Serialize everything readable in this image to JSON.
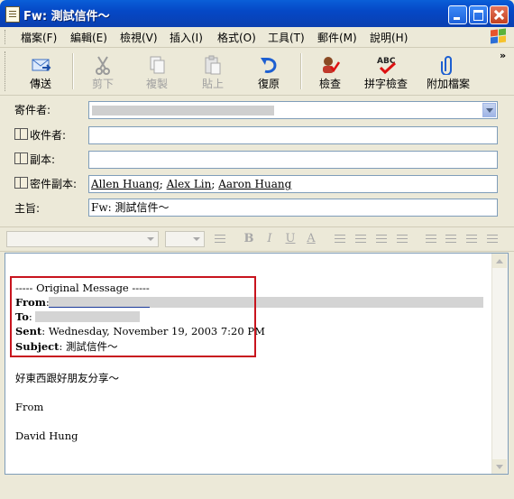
{
  "window": {
    "title": "Fw: 測試信件～"
  },
  "menu": [
    "檔案(F)",
    "編輯(E)",
    "檢視(V)",
    "插入(I)",
    "格式(O)",
    "工具(T)",
    "郵件(M)",
    "說明(H)"
  ],
  "toolbar": {
    "send": "傳送",
    "cut": "剪下",
    "copy": "複製",
    "paste": "貼上",
    "undo": "復原",
    "check": "檢查",
    "spell": "拼字檢查",
    "attach": "附加檔案",
    "more": "»"
  },
  "fields": {
    "from_label": "寄件者:",
    "to_label": "收件者:",
    "cc_label": "副本:",
    "bcc_label": "密件副本:",
    "subject_label": "主旨:",
    "to_value": "",
    "cc_value": "",
    "bcc_names": [
      "Allen Huang",
      "Alex Lin",
      "Aaron Huang"
    ],
    "bcc_sep": ";",
    "subject_value": "Fw: 測試信件～"
  },
  "format": {
    "bold": "B",
    "italic": "I",
    "underline": "U",
    "fontcolor": "A"
  },
  "message": {
    "orig_header": "----- Original Message -----",
    "from_label": "From",
    "to_label": "To",
    "sent_label": "Sent",
    "sent_value": ": Wednesday, November 19, 2003 7:20 PM",
    "subject_label": "Subject",
    "subject_value": ": 測試信件～",
    "line1": "好東西跟好朋友分享～",
    "line2": "From",
    "line3": "David Hung"
  },
  "colors": {
    "title_bar": "#0548c6",
    "highlight_box": "#c8141e",
    "field_border": "#7f9db9"
  }
}
